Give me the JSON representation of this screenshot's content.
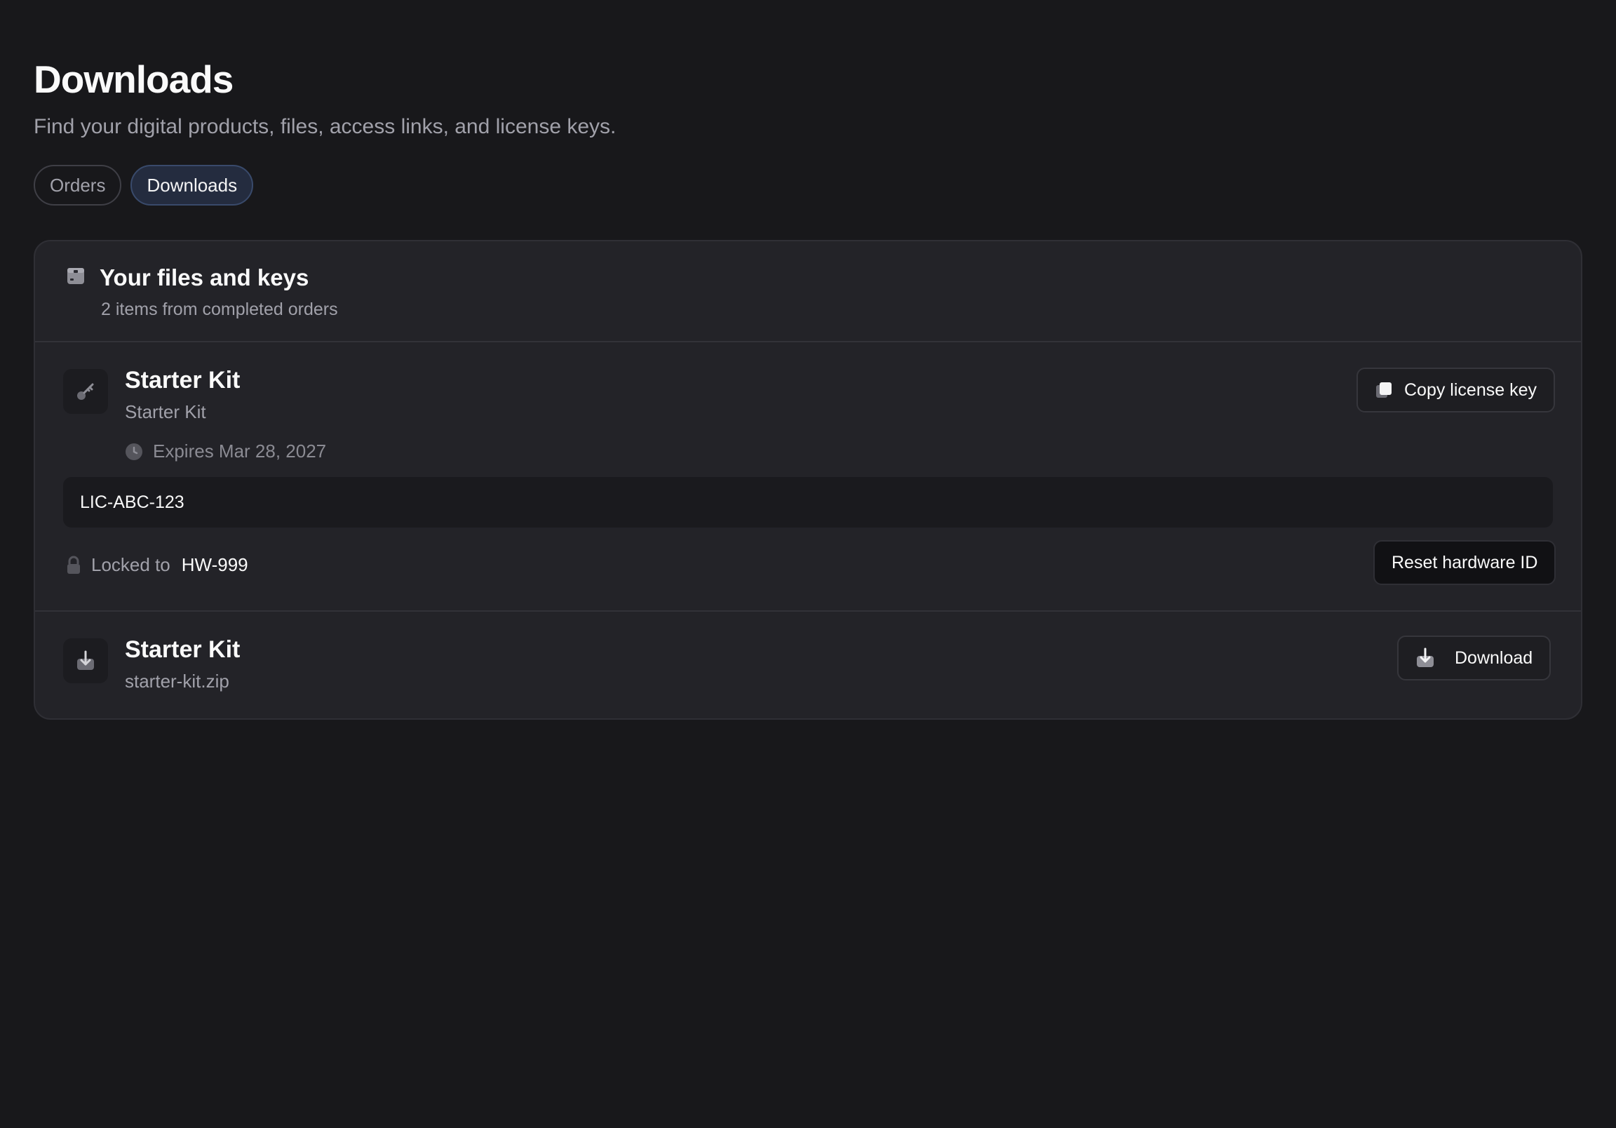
{
  "page": {
    "title": "Downloads",
    "subtitle": "Find your digital products, files, access links, and license keys."
  },
  "tabs": [
    {
      "label": "Orders",
      "active": false
    },
    {
      "label": "Downloads",
      "active": true
    }
  ],
  "card": {
    "title": "Your files and keys",
    "count_text": "2 items from completed orders",
    "header_icon": "archive-box-icon"
  },
  "license_item": {
    "name": "Starter Kit",
    "product": "Starter Kit",
    "expires": "Expires Mar 28, 2027",
    "icon": "key-icon",
    "copy_button": "Copy license key",
    "license_key": "LIC-ABC-123",
    "locked_label": "Locked to",
    "hardware_id": "HW-999",
    "reset_button": "Reset hardware ID"
  },
  "file_item": {
    "name": "Starter Kit",
    "filename": "starter-kit.zip",
    "icon": "download-tray-icon",
    "download_button": "Download"
  },
  "colors": {
    "background": "#18181b",
    "card": "#232328",
    "active_tab": "#242c3f",
    "muted_text": "#a1a1aa"
  }
}
